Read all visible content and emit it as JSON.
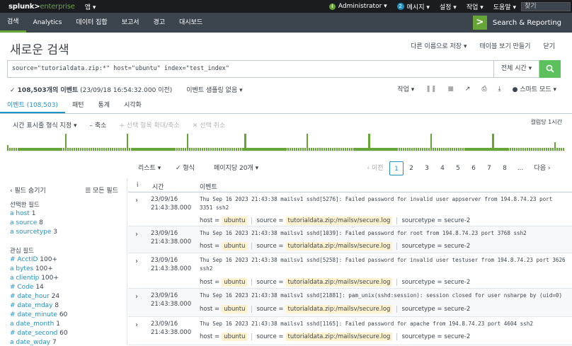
{
  "topbar": {
    "logo_main": "splunk>",
    "logo_sub": "enterprise",
    "app_menu": "앱 ▾",
    "user": "Administrator ▾",
    "msg_count": "2",
    "messages": "메시지 ▾",
    "settings": "설정 ▾",
    "activity": "작업 ▾",
    "help": "도움말 ▾",
    "find_placeholder": "찾기"
  },
  "navbar": {
    "items": [
      "검색",
      "Analytics",
      "데이터 집합",
      "보고서",
      "경고",
      "대시보드"
    ],
    "brand": "Search & Reporting"
  },
  "page": {
    "title": "새로운 검색",
    "actions": [
      "다른 이름으로 저장 ▾",
      "테이블 보기 만들기",
      "닫기"
    ]
  },
  "search": {
    "query": "source=\"tutorialdata.zip:*\" host=\"ubuntu\" index=\"test_index\"",
    "time_range": "전체 시간 ▾"
  },
  "status": {
    "count": "✓ 108,503개의 이벤트",
    "before": "(23/09/18 16:54:32.000 이전)",
    "sampling": "이벤트 샘플링 없음 ▾"
  },
  "jobbar": {
    "job": "작업 ▾",
    "smart": "스마트 모드 ▾"
  },
  "tabs": [
    "이벤트 (108,503)",
    "패턴",
    "통계",
    "시각화"
  ],
  "timeline": {
    "format": "시간 표시줄 형식 지정 ▾",
    "zoom_out": "– 축소",
    "zoom_sel": "+ 선택 항목 확대/축소",
    "deselect": "✕ 선택 취소",
    "scale": "컬럼당 1시간",
    "bars": [
      0.35,
      0.15,
      0.15,
      0.15,
      0.15,
      0.15,
      0.15,
      0.15,
      0.15,
      0.15,
      0.15,
      0.15,
      0.15,
      0.15,
      0.15,
      0.15,
      0.15,
      0.15,
      0.15,
      0.15,
      0.15,
      0.15,
      0.15,
      0.15,
      0.15,
      0.15,
      0.15,
      1.0,
      0.15,
      0.15,
      0.15,
      0.15,
      0.15,
      0.15,
      0.15,
      0.15,
      0.15,
      0.15,
      0.15,
      0.15,
      0.15,
      0.15,
      0.15,
      0.15,
      0.15,
      0.15,
      0.15,
      0.15,
      0.15,
      0.15,
      0.15,
      0.15,
      0.15,
      0.15,
      0.15,
      0.15,
      1.0,
      0.15,
      0.15,
      0.15,
      0.15,
      0.15,
      0.15,
      0.15,
      0.15,
      0.15,
      0.15,
      0.15,
      0.15,
      0.15,
      0.15,
      0.15,
      0.15,
      0.15,
      0.15,
      0.15,
      0.15,
      0.15,
      0.15,
      0.15,
      0.15,
      0.15,
      0.15,
      0.15,
      1.0,
      0.15,
      0.15,
      0.15,
      0.15,
      0.15,
      0.15,
      0.15,
      0.15,
      0.15,
      0.15,
      0.15,
      0.15,
      0.15,
      0.15,
      0.15,
      0.15,
      0.15,
      0.15,
      0.15,
      0.15,
      0.15,
      0.15,
      0.15,
      0.15,
      0.15,
      0.15,
      1.0,
      0.15,
      0.15,
      0.15,
      0.15,
      0.15,
      0.15,
      0.15,
      0.15,
      0.15,
      0.15,
      0.15,
      0.15,
      0.15,
      0.15,
      0.15,
      0.15,
      0.15,
      0.15,
      0.15,
      0.15,
      0.15,
      0.15,
      0.15,
      0.15,
      0.15,
      0.15,
      0.15,
      0.15,
      1.0,
      0.15,
      0.15,
      0.15,
      0.15,
      0.15,
      0.15,
      0.15,
      0.15,
      0.15,
      0.15,
      0.15,
      0.15,
      0.15,
      0.15,
      0.15,
      0.15,
      0.15,
      0.15,
      0.15,
      0.15,
      0.15,
      0.15,
      0.15,
      0.15,
      0.15,
      0.15,
      0.15,
      0.15,
      1.0,
      0.15,
      0.15,
      0.15,
      0.15,
      0.15,
      0.15,
      0.15,
      0.15,
      0.15,
      0.15,
      0.15,
      0.15,
      0.15,
      0.15,
      0.15,
      0.15,
      0.15,
      0.15,
      0.15,
      0.15,
      0.15,
      0.15,
      0.15,
      0.15,
      0.15,
      0.15,
      0.15,
      0.15,
      1.0,
      0.15,
      0.15,
      0.15,
      0.15,
      0.15,
      0.15,
      0.15,
      0.15,
      0.15,
      0.15,
      0.15,
      0.15,
      0.15,
      0.15,
      0.15,
      0.15,
      0.15,
      0.15,
      0.15,
      0.15,
      0.15,
      0.15,
      0.15,
      0.15,
      0.15,
      0.15,
      0.15,
      0.15,
      1.0,
      0.15,
      0.15,
      0.15,
      0.15,
      0.15,
      0.15,
      0.15,
      0.15,
      0.15,
      0.15,
      0.15,
      0.15,
      0.15,
      0.15,
      0.15,
      0.15,
      0.15,
      0.15,
      0.15,
      0.15,
      0.15,
      0.15,
      0.15,
      0.15,
      0.15,
      0.15,
      0.15,
      0.15,
      0.5,
      0.15,
      0.15,
      0.15,
      0.15
    ]
  },
  "controls": {
    "list": "리스트 ▾",
    "format": "✓ 형식",
    "perpage": "페이지당 20개 ▾",
    "prev": "‹ 이전",
    "pages": [
      "1",
      "2",
      "3",
      "4",
      "5",
      "6",
      "7",
      "8",
      "..."
    ],
    "next": "다음 ›"
  },
  "fields": {
    "hide": "‹ 필드 숨기기",
    "all": "☰ 모든 필드",
    "selected_title": "선택한 필드",
    "selected": [
      {
        "name": "a host",
        "count": "1"
      },
      {
        "name": "a source",
        "count": "8"
      },
      {
        "name": "a sourcetype",
        "count": "3"
      }
    ],
    "interesting_title": "관심 필드",
    "interesting": [
      {
        "name": "# AcctID",
        "count": "100+"
      },
      {
        "name": "a bytes",
        "count": "100+"
      },
      {
        "name": "a clientip",
        "count": "100+"
      },
      {
        "name": "# Code",
        "count": "14"
      },
      {
        "name": "# date_hour",
        "count": "24"
      },
      {
        "name": "# date_mday",
        "count": "8"
      },
      {
        "name": "# date_minute",
        "count": "60"
      },
      {
        "name": "a date_month",
        "count": "1"
      },
      {
        "name": "# date_second",
        "count": "60"
      },
      {
        "name": "a date_wday",
        "count": "7"
      }
    ]
  },
  "grid": {
    "col_i": "i",
    "col_time": "시간",
    "col_event": "이벤트",
    "rows": [
      {
        "date": "23/09/16",
        "time": "21:43:38.000",
        "event": "Thu Sep 16 2023 21:43:38 mailsv1 sshd[5276]: Failed password for invalid user appserver from 194.8.74.23 port 3351 ssh2",
        "host": "ubuntu",
        "source": "tutorialdata.zip:/mailsv/secure.log",
        "sourcetype": "secure-2"
      },
      {
        "date": "23/09/16",
        "time": "21:43:38.000",
        "event": "Thu Sep 16 2023 21:43:38 mailsv1 sshd[1039]: Failed password for root from 194.8.74.23 port 3768 ssh2",
        "host": "ubuntu",
        "source": "tutorialdata.zip:/mailsv/secure.log",
        "sourcetype": "secure-2"
      },
      {
        "date": "23/09/16",
        "time": "21:43:38.000",
        "event": "Thu Sep 16 2023 21:43:38 mailsv1 sshd[5258]: Failed password for invalid user testuser from 194.8.74.23 port 3626 ssh2",
        "host": "ubuntu",
        "source": "tutorialdata.zip:/mailsv/secure.log",
        "sourcetype": "secure-2"
      },
      {
        "date": "23/09/16",
        "time": "21:43:38.000",
        "event": "Thu Sep 16 2023 21:43:38 mailsv1 sshd[21881]: pam_unix(sshd:session): session closed for user nsharpe by (uid=0)",
        "host": "ubuntu",
        "source": "tutorialdata.zip:/mailsv/secure.log",
        "sourcetype": "secure-2"
      },
      {
        "date": "23/09/16",
        "time": "21:43:38.000",
        "event": "Thu Sep 16 2023 21:43:38 mailsv1 sshd[1165]: Failed password for apache from 194.8.74.23 port 4604 ssh2",
        "host": "ubuntu",
        "source": "tutorialdata.zip:/mailsv/secure.log",
        "sourcetype": "secure-2"
      }
    ],
    "k_host": "host =",
    "k_source": "source =",
    "k_sourcetype": "sourcetype ="
  }
}
